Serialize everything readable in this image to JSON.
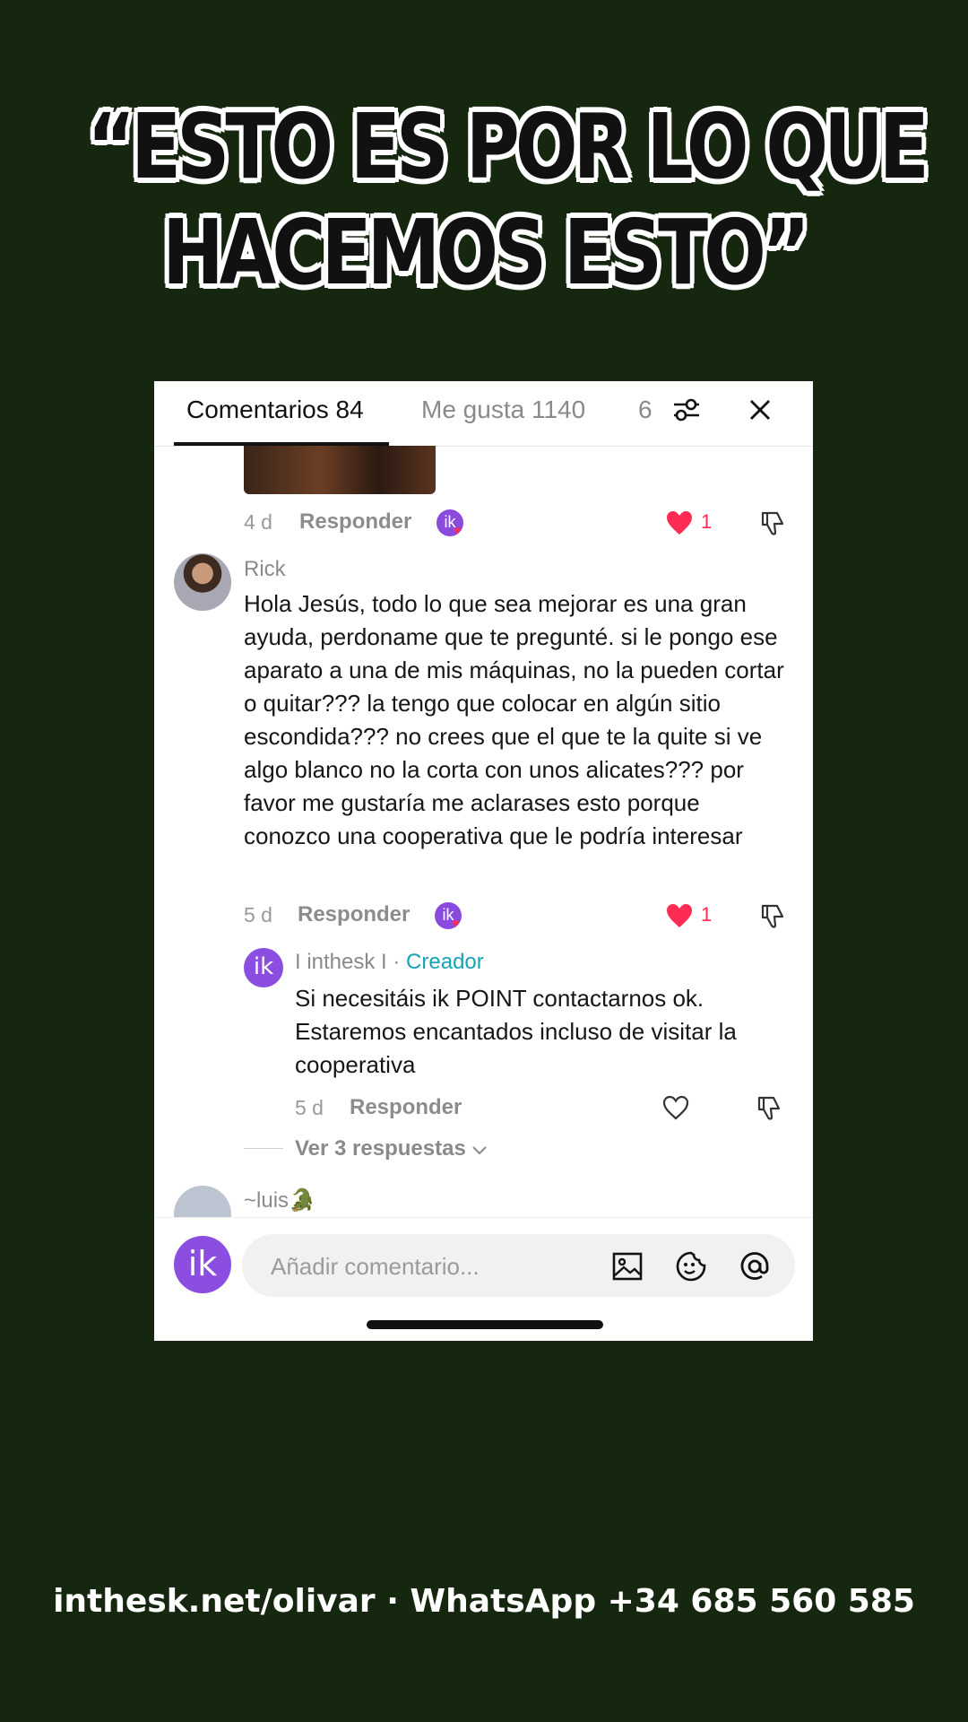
{
  "headline": {
    "line1": "“ESTO ES POR LO QUE",
    "line2": "HACEMOS ESTO”"
  },
  "tabs": {
    "comments": "Comentarios 84",
    "likes": "Me gusta 1140",
    "shares": "6"
  },
  "icons": {
    "filter": "sliders-icon",
    "close": "close-icon"
  },
  "comment_prev": {
    "time": "4 d",
    "reply": "Responder",
    "like_count": "1"
  },
  "comment_rick": {
    "username": "Rick",
    "text": "Hola Jesús, todo lo que sea mejorar es una gran ayuda, perdoname que te pregunté. si le pongo ese aparato a una de mis máquinas, no la pueden cortar o quitar??? la tengo que colocar en algún sitio escondida??? no crees que el que te la quite si ve algo blanco no la corta con unos alicates??? por favor me gustaría me aclarases esto porque conozco una cooperativa que le podría interesar",
    "time": "5 d",
    "reply": "Responder",
    "like_count": "1"
  },
  "reply_creator": {
    "avatar_text": "ik",
    "username": "I inthesk I",
    "separator": " · ",
    "badge": "Creador",
    "text": "Si necesitáis ik POINT contactarnos ok. Estaremos encantados incluso de visitar la cooperativa",
    "time": "5 d",
    "reply": "Responder"
  },
  "view_replies": "Ver 3 respuestas",
  "comment_luis": {
    "username": "~luis🐊"
  },
  "composer": {
    "avatar_text": "ik",
    "placeholder": "Añadir comentario..."
  },
  "footer": "inthesk.net/olivar · WhatsApp +34 685 560 585",
  "colors": {
    "background": "#16270f",
    "like": "#fe2c55",
    "creator": "#16a3b8",
    "brand": "#8b4ee0"
  }
}
